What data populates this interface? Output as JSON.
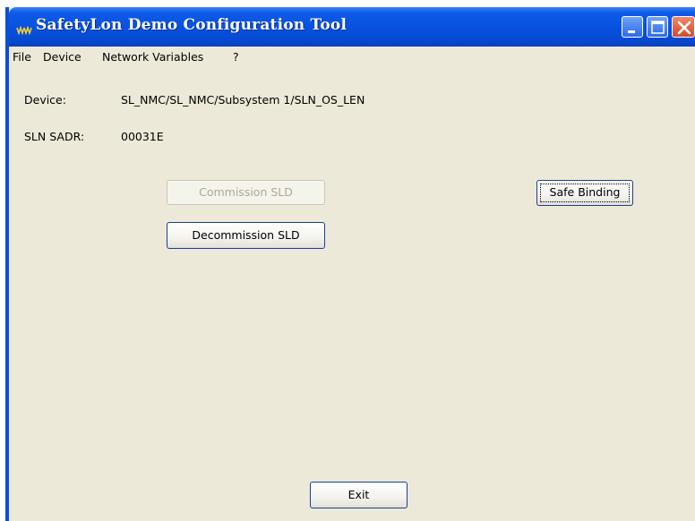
{
  "window": {
    "title": "SafetyLon Demo Configuration Tool"
  },
  "menu": {
    "items": [
      "File",
      "Device",
      "Network Variables",
      "?"
    ]
  },
  "device": {
    "label": "Device:",
    "value": "SL_NMC/SL_NMC/Subsystem 1/SLN_OS_LEN"
  },
  "sadr": {
    "label": "SLN SADR:",
    "value": "00031E"
  },
  "buttons": {
    "commission": "Commission SLD",
    "decommission": "Decommission SLD",
    "safe_binding": "Safe Binding",
    "exit": "Exit"
  },
  "colors": {
    "titlebar": "#0852df",
    "window_bg": "#ece9d8",
    "close_button": "#d34a2b"
  },
  "icons": {
    "app": "app-icon",
    "minimize": "minimize-icon",
    "maximize": "maximize-icon",
    "close": "close-icon"
  }
}
